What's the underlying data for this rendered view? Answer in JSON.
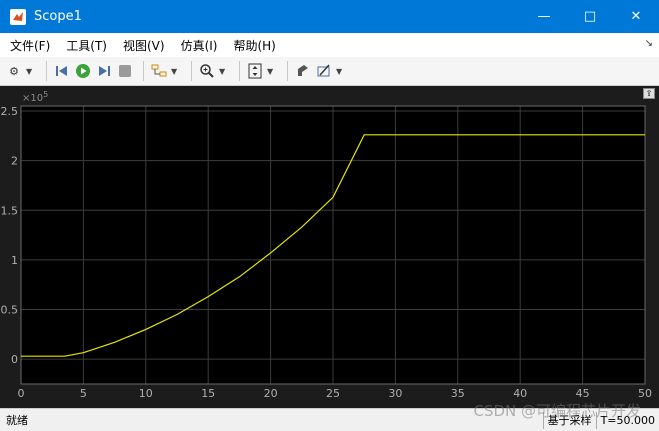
{
  "window": {
    "title": "Scope1"
  },
  "menu": {
    "items": [
      {
        "label": "文件(F)"
      },
      {
        "label": "工具(T)"
      },
      {
        "label": "视图(V)"
      },
      {
        "label": "仿真(I)"
      },
      {
        "label": "帮助(H)"
      }
    ]
  },
  "toolbar": {
    "icons": [
      "gear-icon",
      "step-back-icon",
      "run-icon",
      "step-forward-icon",
      "stop-icon",
      "layout-icon",
      "zoom-icon",
      "autoscale-icon",
      "highlight-icon",
      "cursor-measure-icon"
    ]
  },
  "colors": {
    "background": "#000000",
    "grid": "#3d3d3d",
    "trace": "#e6e600",
    "tick_text": "#b0b0b0"
  },
  "chart_data": {
    "type": "line",
    "xlim": [
      0,
      50
    ],
    "ylim": [
      -0.25,
      2.55
    ],
    "y_exponent": "×10",
    "y_exponent_power": "5",
    "x_ticks": [
      "0",
      "5",
      "10",
      "15",
      "20",
      "25",
      "30",
      "35",
      "40",
      "45",
      "50"
    ],
    "y_ticks": [
      "0",
      "0.5",
      "1",
      "1.5",
      "2",
      "2.5"
    ],
    "grid": true,
    "series": [
      {
        "x": [
          0,
          3.5,
          5,
          7.5,
          10,
          12.5,
          15,
          17.5,
          20,
          22.5,
          25,
          27.5,
          28,
          50
        ],
        "y": [
          0.03,
          0.03,
          0.065,
          0.17,
          0.3,
          0.45,
          0.63,
          0.83,
          1.07,
          1.33,
          1.63,
          2.26,
          2.26,
          2.26
        ]
      }
    ]
  },
  "status": {
    "left": "就绪",
    "sample": "基于采样",
    "time": "T=50.000"
  },
  "watermark": "CSDN @可编程芯片开发"
}
